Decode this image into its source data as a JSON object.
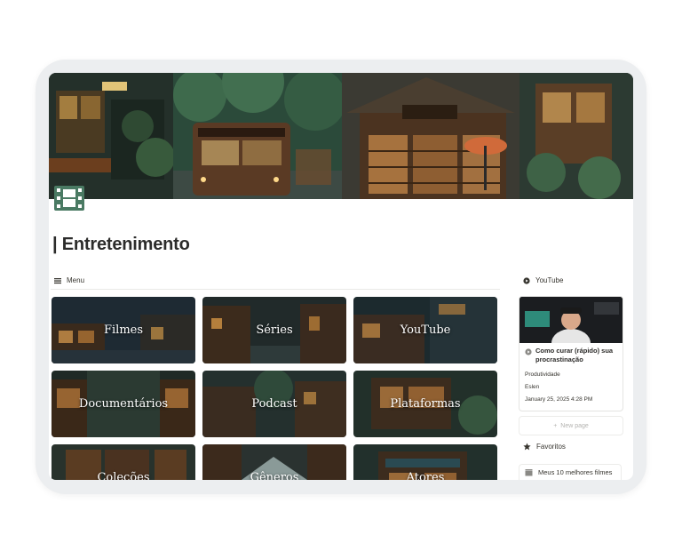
{
  "page": {
    "title": "| Entretenimento",
    "cover_icon": "film-strip-icon"
  },
  "menu": {
    "header": "Menu",
    "cards": [
      {
        "label": "Filmes"
      },
      {
        "label": "Séries"
      },
      {
        "label": "YouTube"
      },
      {
        "label": "Documentários"
      },
      {
        "label": "Podcast"
      },
      {
        "label": "Plataformas"
      },
      {
        "label": "Coleções"
      },
      {
        "label": "Gêneros"
      },
      {
        "label": "Atores"
      }
    ]
  },
  "youtube": {
    "header": "YouTube",
    "video": {
      "title": "Como curar (rápido) sua procrastinação",
      "category": "Produtividade",
      "channel": "Eslen",
      "date": "January 25, 2025 4:28 PM"
    },
    "new_page_label": "New page"
  },
  "favorites": {
    "header": "Favoritos",
    "items": [
      {
        "label": "Meus 10 melhores filmes"
      }
    ]
  },
  "colors": {
    "icon_green": "#4a7a63",
    "text": "#37352f",
    "title": "#2c2c2b"
  }
}
